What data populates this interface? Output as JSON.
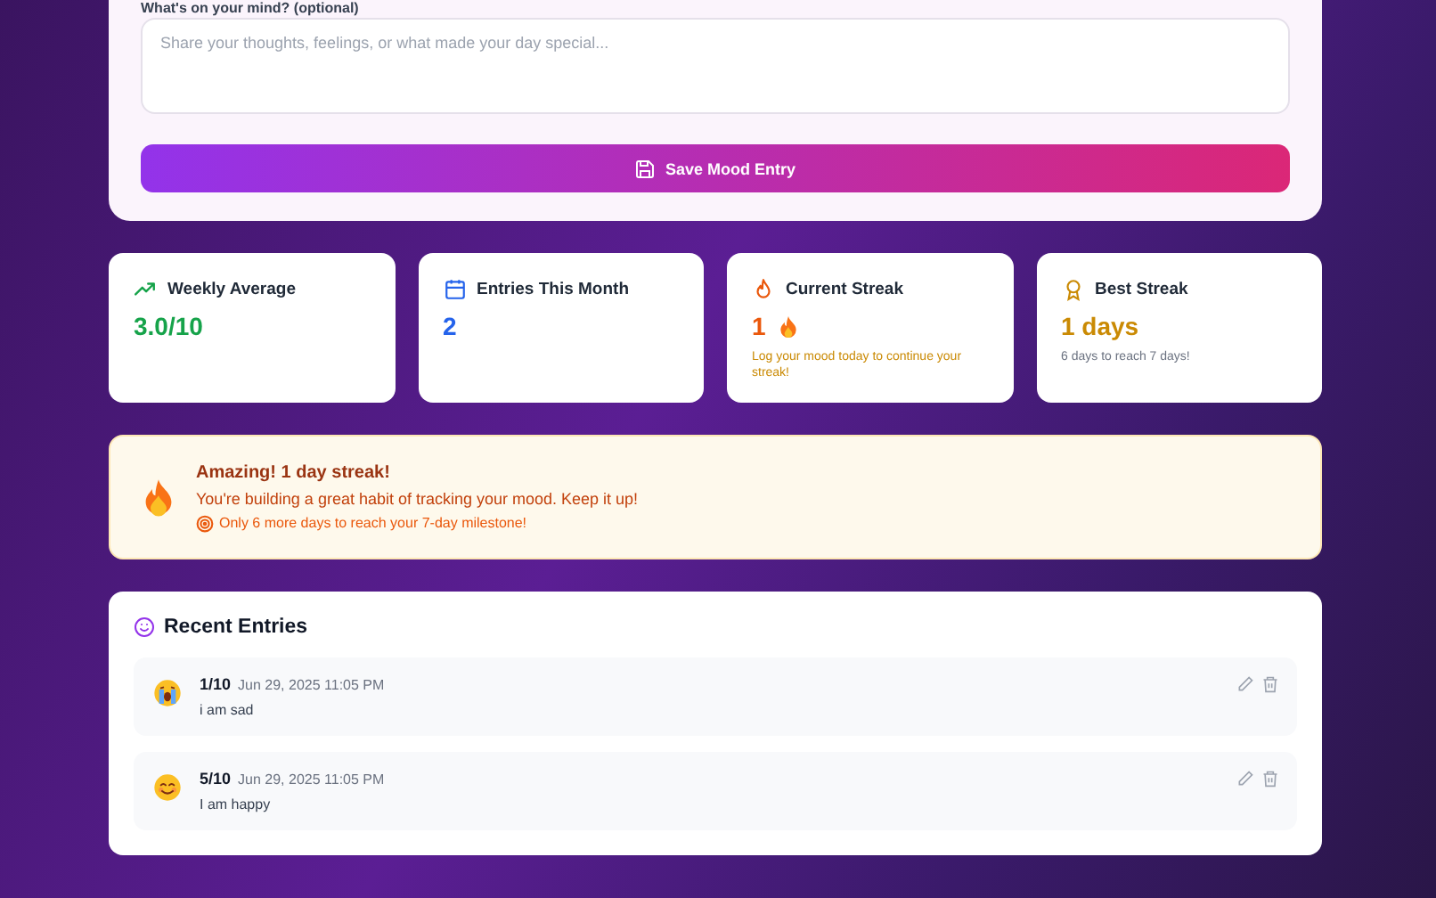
{
  "form": {
    "label": "What's on your mind? (optional)",
    "placeholder": "Share your thoughts, feelings, or what made your day special...",
    "save_button": "Save Mood Entry"
  },
  "stats": [
    {
      "kind": "average",
      "title": "Weekly Average",
      "value": "3.0/10"
    },
    {
      "kind": "entries",
      "title": "Entries This Month",
      "value": "2"
    },
    {
      "kind": "streak",
      "title": "Current Streak",
      "value": "1",
      "note": "Log your mood today to continue your streak!"
    },
    {
      "kind": "best",
      "title": "Best Streak",
      "value": "1 days",
      "note": "6 days to reach 7 days!"
    }
  ],
  "banner": {
    "title": "Amazing! 1 day streak!",
    "message": "You're building a great habit of tracking your mood. Keep it up!",
    "milestone": "Only 6 more days to reach your 7-day milestone!"
  },
  "recent": {
    "title": "Recent Entries",
    "entries": [
      {
        "kind": "crying",
        "score": "1/10",
        "date": "Jun 29, 2025 11:05 PM",
        "note": "i am sad"
      },
      {
        "kind": "smiling",
        "score": "5/10",
        "date": "Jun 29, 2025 11:05 PM",
        "note": "I am happy"
      }
    ]
  }
}
